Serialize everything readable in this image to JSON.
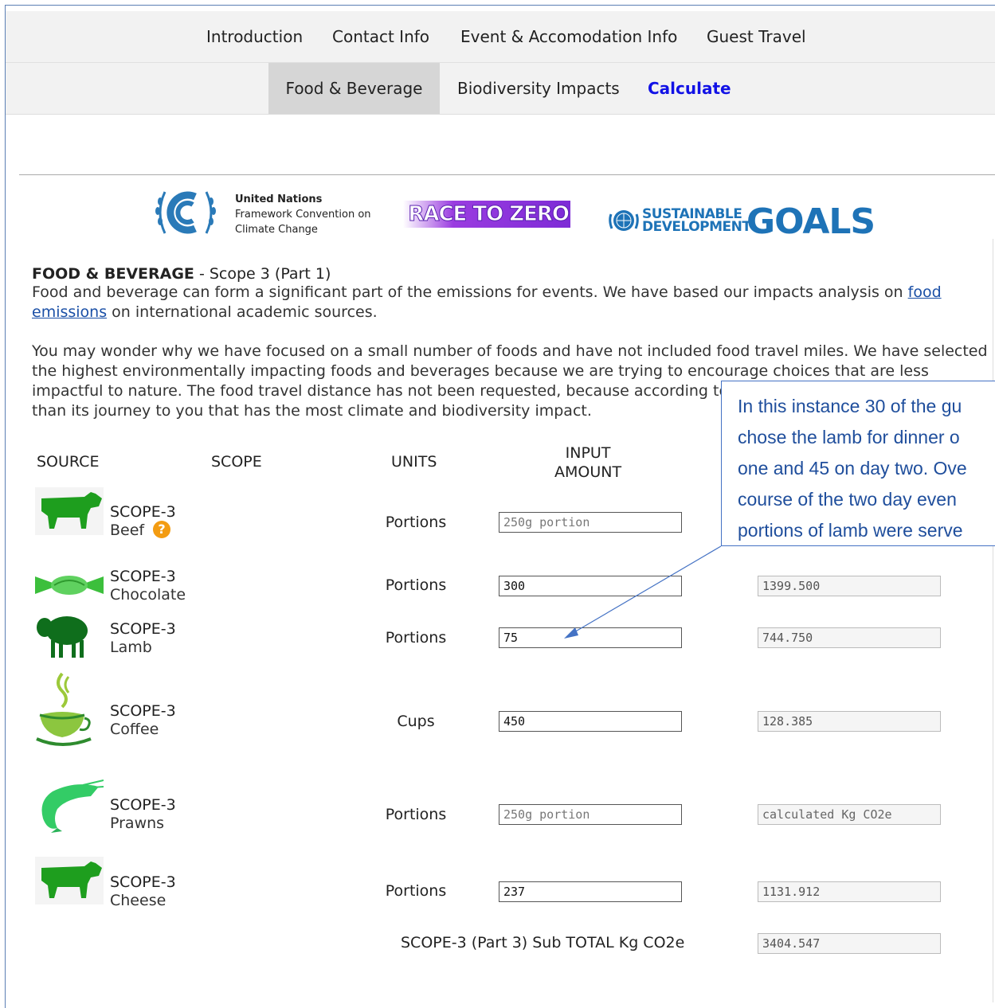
{
  "nav": {
    "row1": [
      "Introduction",
      "Contact Info",
      "Event & Accomodation Info",
      "Guest Travel"
    ],
    "row2": [
      "Food & Beverage",
      "Biodiversity Impacts",
      "Calculate"
    ]
  },
  "logos": {
    "unfccc_line1": "United Nations",
    "unfccc_line2": "Framework Convention on",
    "unfccc_line3": "Climate Change",
    "rtz": "RACE TO ZERO",
    "sdg_line1": "SUSTAINABLE",
    "sdg_line2": "DEVELOPMENT",
    "sdg_goals": "GOALS"
  },
  "intro": {
    "heading_bold": "FOOD & BEVERAGE",
    "heading_rest": " - Scope 3 (Part 1)",
    "p1_a": "Food and beverage can form a significant part of the emissions for events. We have based our impacts analysis on ",
    "p1_link": "food emissions",
    "p1_b": " on international academic sources.",
    "p2": "You may wonder why we have focused on a small number of foods and have not included food travel miles. We have selected the highest environmentally impacting foods and beverages because we are trying to encourage choices that are less impactful to nature. The food travel distance has not been requested, because according to studies it is what you eat rather than its journey to you that has the most climate and biodiversity impact."
  },
  "table": {
    "headers": {
      "source": "SOURCE",
      "scope": "SCOPE",
      "units": "UNITS",
      "input_l1": "INPUT",
      "input_l2": "AMOUNT"
    },
    "rows": [
      {
        "scope": "SCOPE-3",
        "food": "Beef",
        "unit": "Portions",
        "input": "",
        "input_ph": "250g portion",
        "output": "",
        "output_ph": ""
      },
      {
        "scope": "SCOPE-3",
        "food": "Chocolate",
        "unit": "Portions",
        "input": "300",
        "input_ph": "",
        "output": "1399.500",
        "output_ph": ""
      },
      {
        "scope": "SCOPE-3",
        "food": "Lamb",
        "unit": "Portions",
        "input": "75",
        "input_ph": "",
        "output": "744.750",
        "output_ph": ""
      },
      {
        "scope": "SCOPE-3",
        "food": "Coffee",
        "unit": "Cups",
        "input": "450",
        "input_ph": "",
        "output": "128.385",
        "output_ph": ""
      },
      {
        "scope": "SCOPE-3",
        "food": "Prawns",
        "unit": "Portions",
        "input": "",
        "input_ph": "250g portion",
        "output": "",
        "output_ph": "calculated Kg CO2e"
      },
      {
        "scope": "SCOPE-3",
        "food": "Cheese",
        "unit": "Portions",
        "input": "237",
        "input_ph": "",
        "output": "1131.912",
        "output_ph": ""
      }
    ],
    "subtotal_label": "SCOPE-3 (Part 3) Sub TOTAL Kg CO2e",
    "subtotal_value": "3404.547"
  },
  "callout": {
    "lines": [
      "In this instance 30 of the gu",
      "chose the lamb for dinner o",
      "one and 45 on day two. Ove",
      "course of the two day even",
      "portions of lamb were serve"
    ]
  },
  "colors": {
    "accent_link": "#1212e6",
    "callout_text": "#1f4e9c",
    "food_green": "#1e9e1e"
  }
}
